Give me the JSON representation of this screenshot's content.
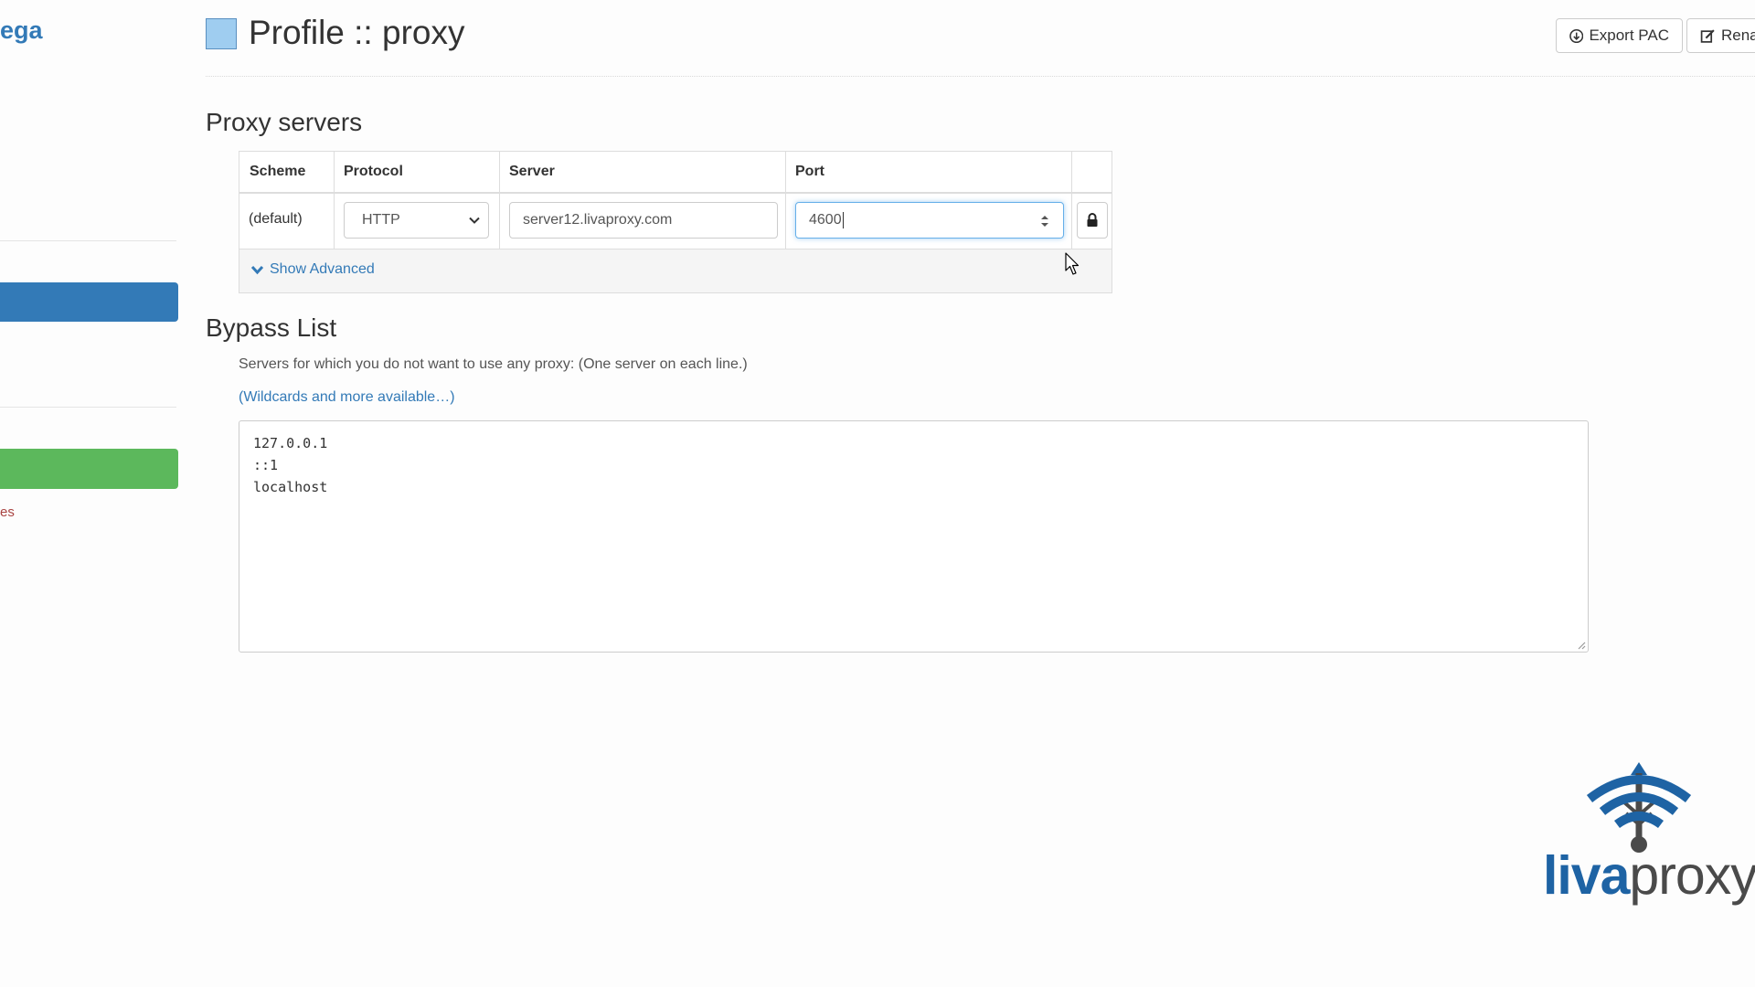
{
  "sidebar": {
    "brand_fragment": "ega",
    "bottom_fragment": "es"
  },
  "header": {
    "title": "Profile :: proxy",
    "profile_color": "#9fcdf0",
    "export_pac_label": "Export PAC",
    "rename_label": "Rena"
  },
  "proxy_servers": {
    "heading": "Proxy servers",
    "columns": [
      "Scheme",
      "Protocol",
      "Server",
      "Port"
    ],
    "row": {
      "scheme": "(default)",
      "protocol": "HTTP",
      "server": "server12.livaproxy.com",
      "port": "4600"
    },
    "show_advanced_label": "Show Advanced"
  },
  "bypass": {
    "heading": "Bypass List",
    "help_text": "Servers for which you do not want to use any proxy: (One server on each line.)",
    "wildcards_link": "(Wildcards and more available…)",
    "entries": [
      "127.0.0.1",
      "::1",
      "localhost"
    ]
  },
  "logo": {
    "part1": "liva",
    "part2": "proxy",
    "primary_color": "#1e63a4"
  }
}
